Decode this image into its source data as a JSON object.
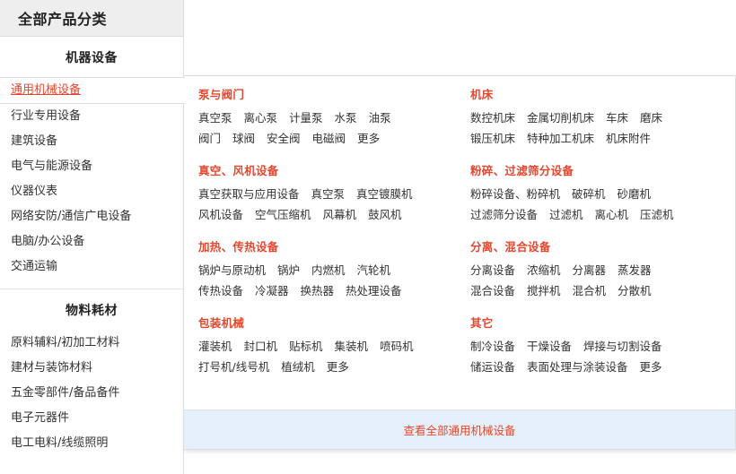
{
  "sidebar": {
    "header_title": "全部产品分类",
    "groups": [
      {
        "heading": "机器设备",
        "items": [
          {
            "label": "通用机械设备",
            "selected": true
          },
          {
            "label": "行业专用设备",
            "selected": false
          },
          {
            "label": "建筑设备",
            "selected": false
          },
          {
            "label": "电气与能源设备",
            "selected": false
          },
          {
            "label": "仪器仪表",
            "selected": false
          },
          {
            "label": "网络安防/通信广电设备",
            "selected": false
          },
          {
            "label": "电脑/办公设备",
            "selected": false
          },
          {
            "label": "交通运输",
            "selected": false
          }
        ]
      },
      {
        "heading": "物料耗材",
        "items": [
          {
            "label": "原料辅料/初加工材料",
            "selected": false
          },
          {
            "label": "建材与装饰材料",
            "selected": false
          },
          {
            "label": "五金零部件/备品备件",
            "selected": false
          },
          {
            "label": "电子元器件",
            "selected": false
          },
          {
            "label": "电工电料/线缆照明",
            "selected": false
          }
        ]
      }
    ]
  },
  "panel": {
    "columns": [
      {
        "sections": [
          {
            "title": "泵与阀门",
            "rows": [
              [
                "真空泵",
                "离心泵",
                "计量泵",
                "水泵",
                "油泵"
              ],
              [
                "阀门",
                "球阀",
                "安全阀",
                "电磁阀",
                "更多"
              ]
            ]
          },
          {
            "title": "真空、风机设备",
            "rows": [
              [
                "真空获取与应用设备",
                "真空泵",
                "真空镀膜机"
              ],
              [
                "风机设备",
                "空气压缩机",
                "风幕机",
                "鼓风机"
              ]
            ]
          },
          {
            "title": "加热、传热设备",
            "rows": [
              [
                "锅炉与原动机",
                "锅炉",
                "内燃机",
                "汽轮机"
              ],
              [
                "传热设备",
                "冷凝器",
                "换热器",
                "热处理设备"
              ]
            ]
          },
          {
            "title": "包装机械",
            "rows": [
              [
                "灌装机",
                "封口机",
                "贴标机",
                "集装机",
                "喷码机"
              ],
              [
                "打号机/线号机",
                "植绒机",
                "更多"
              ]
            ]
          }
        ]
      },
      {
        "sections": [
          {
            "title": "机床",
            "rows": [
              [
                "数控机床",
                "金属切削机床",
                "车床",
                "磨床"
              ],
              [
                "锻压机床",
                "特种加工机床",
                "机床附件"
              ]
            ]
          },
          {
            "title": "粉碎、过滤筛分设备",
            "rows": [
              [
                "粉碎设备、粉碎机",
                "破碎机",
                "砂磨机"
              ],
              [
                "过滤筛分设备",
                "过滤机",
                "离心机",
                "压滤机"
              ]
            ]
          },
          {
            "title": "分离、混合设备",
            "rows": [
              [
                "分离设备",
                "浓缩机",
                "分离器",
                "蒸发器"
              ],
              [
                "混合设备",
                "搅拌机",
                "混合机",
                "分散机"
              ]
            ]
          },
          {
            "title": "其它",
            "rows": [
              [
                "制冷设备",
                "干燥设备",
                "焊接与切割设备"
              ],
              [
                "储运设备",
                "表面处理与涂装设备",
                "更多"
              ]
            ]
          }
        ]
      }
    ],
    "footer_link": "查看全部通用机械设备"
  },
  "colors": {
    "accent_red": "#e4472e",
    "header_bg": "#eeeeee",
    "footer_bg": "#e6f0fb",
    "border": "#dddddd"
  }
}
